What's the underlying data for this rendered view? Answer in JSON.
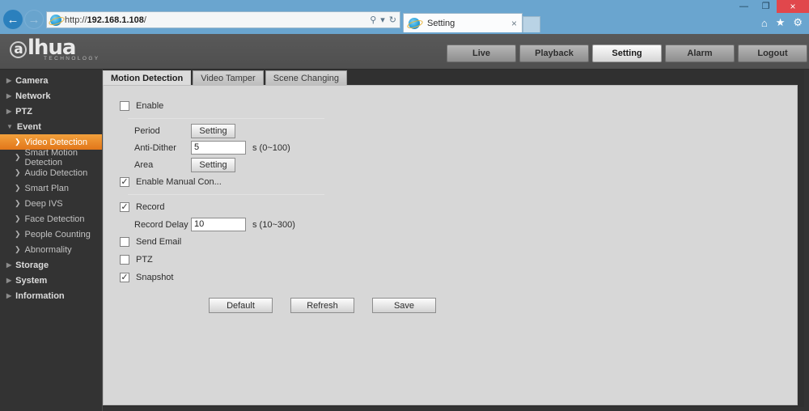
{
  "browser": {
    "url_prefix": "http://",
    "url_host": "192.168.1.108",
    "url_suffix": "/",
    "back_icon": "back-arrow-icon",
    "forward_icon": "forward-arrow-icon",
    "search_icon": "search-magnifier-icon",
    "search_dropdown_icon": "chevron-down-icon",
    "refresh_icon": "refresh-icon",
    "home_icon": "home-icon",
    "favorites_icon": "star-icon",
    "tools_icon": "gear-icon",
    "minimize_label": "—",
    "maximize_label": "❐",
    "close_label": "×",
    "tab": {
      "title": "Setting",
      "close_label": "×",
      "favicon": "ie-browser-icon"
    }
  },
  "header": {
    "logo_mark": "a",
    "logo_text": "lhua",
    "logo_sub": "TECHNOLOGY",
    "nav": [
      {
        "label": "Live",
        "active": false
      },
      {
        "label": "Playback",
        "active": false
      },
      {
        "label": "Setting",
        "active": true
      },
      {
        "label": "Alarm",
        "active": false
      },
      {
        "label": "Logout",
        "active": false
      }
    ]
  },
  "sidebar": {
    "items": [
      {
        "label": "Camera",
        "level": "top",
        "arrow": "▶",
        "active": false
      },
      {
        "label": "Network",
        "level": "top",
        "arrow": "▶",
        "active": false
      },
      {
        "label": "PTZ",
        "level": "top",
        "arrow": "▶",
        "active": false
      },
      {
        "label": "Event",
        "level": "top",
        "arrow": "▼",
        "active": false
      },
      {
        "label": "Video Detection",
        "level": "sub",
        "arrow": "❯",
        "active": true
      },
      {
        "label": "Smart Motion Detection",
        "level": "sub",
        "arrow": "❯",
        "active": false
      },
      {
        "label": "Audio Detection",
        "level": "sub",
        "arrow": "❯",
        "active": false
      },
      {
        "label": "Smart Plan",
        "level": "sub",
        "arrow": "❯",
        "active": false
      },
      {
        "label": "Deep IVS",
        "level": "sub",
        "arrow": "❯",
        "active": false
      },
      {
        "label": "Face Detection",
        "level": "sub",
        "arrow": "❯",
        "active": false
      },
      {
        "label": "People Counting",
        "level": "sub",
        "arrow": "❯",
        "active": false
      },
      {
        "label": "Abnormality",
        "level": "sub",
        "arrow": "❯",
        "active": false
      },
      {
        "label": "Storage",
        "level": "top",
        "arrow": "▶",
        "active": false
      },
      {
        "label": "System",
        "level": "top",
        "arrow": "▶",
        "active": false
      },
      {
        "label": "Information",
        "level": "top",
        "arrow": "▶",
        "active": false
      }
    ]
  },
  "content": {
    "tabs": [
      {
        "label": "Motion Detection",
        "active": true
      },
      {
        "label": "Video Tamper",
        "active": false
      },
      {
        "label": "Scene Changing",
        "active": false
      }
    ],
    "form": {
      "enable": {
        "label": "Enable",
        "checked": false,
        "mark": ""
      },
      "period": {
        "label": "Period",
        "button": "Setting"
      },
      "anti_dither": {
        "label": "Anti-Dither",
        "value": "5",
        "unit": "s (0~100)"
      },
      "area": {
        "label": "Area",
        "button": "Setting"
      },
      "manual_control": {
        "label": "Enable Manual Con...",
        "checked": true,
        "mark": "✓"
      },
      "record": {
        "label": "Record",
        "checked": true,
        "mark": "✓"
      },
      "record_delay": {
        "label": "Record Delay",
        "value": "10",
        "unit": "s (10~300)"
      },
      "send_email": {
        "label": "Send Email",
        "checked": false,
        "mark": ""
      },
      "ptz": {
        "label": "PTZ",
        "checked": false,
        "mark": ""
      },
      "snapshot": {
        "label": "Snapshot",
        "checked": true,
        "mark": "✓"
      }
    },
    "buttons": {
      "default": "Default",
      "refresh": "Refresh",
      "save": "Save"
    }
  },
  "colors": {
    "accent_orange": "#e2761a",
    "browser_blue": "#6aa5cf",
    "close_red": "#e1474c",
    "panel_gray": "#d7d7d7",
    "sidebar_dark": "#333333"
  }
}
